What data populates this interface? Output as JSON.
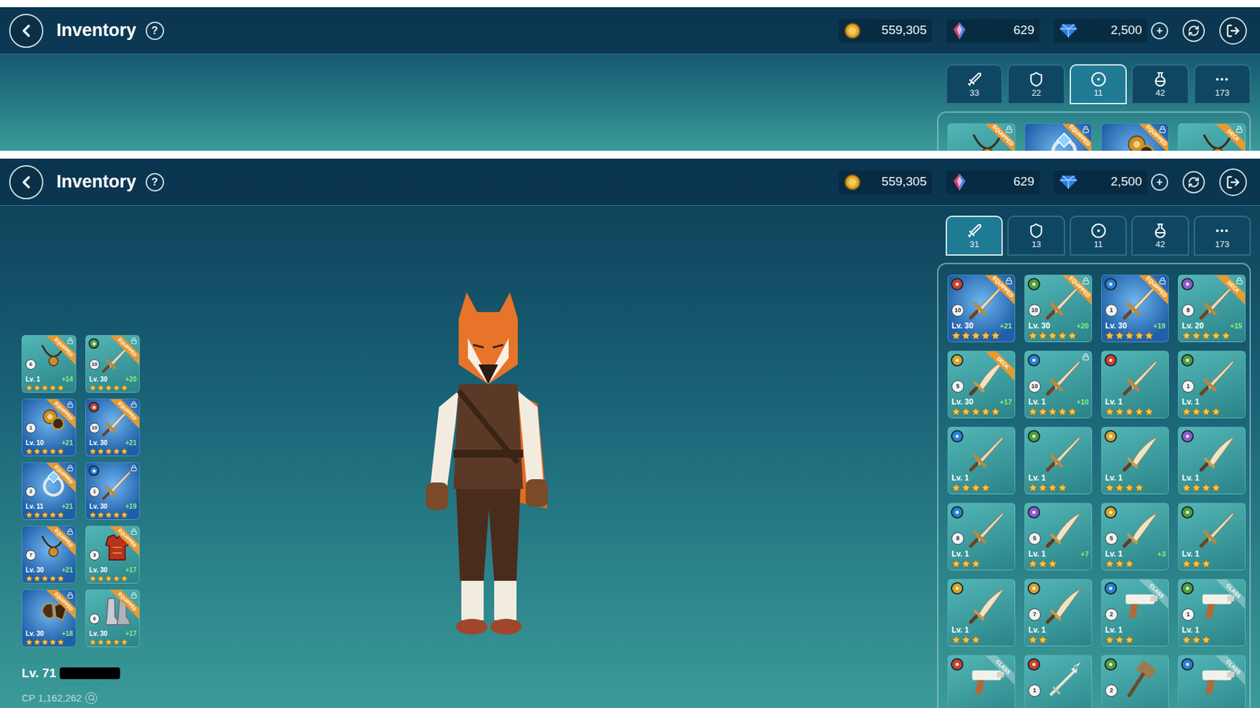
{
  "screens": [
    {
      "title": "Inventory",
      "help": "?",
      "add": "+",
      "currencies": [
        {
          "kind": "gold",
          "value": "559,305"
        },
        {
          "kind": "crystal",
          "value": "629"
        },
        {
          "kind": "gem",
          "value": "2,500"
        }
      ],
      "tabs": [
        {
          "kind": "weapon",
          "count": "33",
          "selected": false
        },
        {
          "kind": "armor",
          "count": "22",
          "selected": false
        },
        {
          "kind": "accessory",
          "count": "11",
          "selected": true
        },
        {
          "kind": "consumable",
          "count": "42",
          "selected": false
        },
        {
          "kind": "more",
          "count": "173",
          "selected": false
        }
      ],
      "items": [
        {
          "kind": "necklace",
          "badge": "EQUIPPED",
          "badge_kind": "status",
          "locked": true,
          "glow": false
        },
        {
          "kind": "ring",
          "badge": "EQUIPPED",
          "badge_kind": "status",
          "locked": true,
          "glow": true
        },
        {
          "kind": "jewel",
          "badge": "EQUIPPED",
          "badge_kind": "status",
          "locked": true,
          "glow": true
        },
        {
          "kind": "necklace",
          "badge": "DECK",
          "badge_kind": "status",
          "locked": true,
          "glow": false
        }
      ]
    },
    {
      "title": "Inventory",
      "help": "?",
      "add": "+",
      "currencies": [
        {
          "kind": "gold",
          "value": "559,305"
        },
        {
          "kind": "crystal",
          "value": "629"
        },
        {
          "kind": "gem",
          "value": "2,500"
        }
      ],
      "tabs": [
        {
          "kind": "weapon",
          "count": "31",
          "selected": true
        },
        {
          "kind": "armor",
          "count": "13",
          "selected": false
        },
        {
          "kind": "accessory",
          "count": "11",
          "selected": false
        },
        {
          "kind": "consumable",
          "count": "42",
          "selected": false
        },
        {
          "kind": "more",
          "count": "173",
          "selected": false
        }
      ],
      "items": [
        {
          "kind": "sword",
          "color": "#c8402f",
          "rank": "10",
          "level": "Lv. 30",
          "plus": "+21",
          "stars": 5,
          "badge": "EQUIPPED",
          "badge_kind": "status",
          "locked": true,
          "glow": true
        },
        {
          "kind": "sword",
          "color": "#4e9f3d",
          "rank": "10",
          "level": "Lv. 30",
          "plus": "+20",
          "stars": 5,
          "badge": "EQUIPPED",
          "badge_kind": "status",
          "locked": true,
          "glow": false
        },
        {
          "kind": "sword",
          "color": "#2a7fd4",
          "rank": "1",
          "level": "Lv. 30",
          "plus": "+19",
          "stars": 5,
          "badge": "EQUIPPED",
          "badge_kind": "status",
          "locked": true,
          "glow": true
        },
        {
          "kind": "sword",
          "color": "#8e5bc9",
          "rank": "8",
          "level": "Lv. 20",
          "plus": "+15",
          "stars": 5,
          "badge": "DECK",
          "badge_kind": "status",
          "locked": true,
          "glow": false
        },
        {
          "kind": "curved",
          "color": "#d4a52a",
          "rank": "5",
          "level": "Lv. 30",
          "plus": "+17",
          "stars": 5,
          "badge": "DECK",
          "badge_kind": "status",
          "locked": false,
          "glow": false
        },
        {
          "kind": "sword",
          "color": "#2a7fd4",
          "rank": "10",
          "level": "Lv. 1",
          "plus": "+10",
          "stars": 5,
          "locked": true,
          "glow": false
        },
        {
          "kind": "sword",
          "color": "#c8402f",
          "level": "Lv. 1",
          "stars": 5,
          "locked": false,
          "glow": false
        },
        {
          "kind": "sword",
          "color": "#4e9f3d",
          "rank": "1",
          "level": "Lv. 1",
          "stars": 4,
          "locked": false,
          "glow": false
        },
        {
          "kind": "sword",
          "color": "#2a7fd4",
          "level": "Lv. 1",
          "stars": 4,
          "locked": false,
          "glow": false
        },
        {
          "kind": "sword",
          "color": "#4e9f3d",
          "level": "Lv. 1",
          "stars": 4,
          "locked": false,
          "glow": false
        },
        {
          "kind": "curved",
          "color": "#d4a52a",
          "level": "Lv. 1",
          "stars": 4,
          "locked": false,
          "glow": false
        },
        {
          "kind": "curved",
          "color": "#8e5bc9",
          "level": "Lv. 1",
          "stars": 4,
          "locked": false,
          "glow": false
        },
        {
          "kind": "sword",
          "color": "#2a7fd4",
          "rank": "8",
          "level": "Lv. 1",
          "stars": 3,
          "locked": false,
          "glow": false
        },
        {
          "kind": "curved",
          "color": "#8e5bc9",
          "rank": "5",
          "level": "Lv. 1",
          "plus": "+7",
          "stars": 3,
          "locked": false,
          "glow": false
        },
        {
          "kind": "curved",
          "color": "#d4a52a",
          "rank": "5",
          "level": "Lv. 1",
          "plus": "+3",
          "stars": 3,
          "locked": false,
          "glow": false
        },
        {
          "kind": "sword",
          "color": "#4e9f3d",
          "level": "Lv. 1",
          "stars": 3,
          "locked": false,
          "glow": false
        },
        {
          "kind": "curved",
          "color": "#d4a52a",
          "level": "Lv. 1",
          "stars": 3,
          "locked": false,
          "glow": false
        },
        {
          "kind": "curved",
          "color": "#d4a52a",
          "rank": "7",
          "level": "Lv. 1",
          "stars": 2,
          "locked": false,
          "glow": false
        },
        {
          "kind": "gun",
          "color": "#2a7fd4",
          "rank": "2",
          "level": "Lv. 1",
          "stars": 3,
          "badge": "CLASS",
          "badge_kind": "class",
          "locked": false,
          "glow": false
        },
        {
          "kind": "gun",
          "color": "#4e9f3d",
          "rank": "1",
          "level": "Lv. 1",
          "stars": 3,
          "badge": "CLASS",
          "badge_kind": "class",
          "locked": false,
          "glow": false
        },
        {
          "kind": "gun",
          "color": "#c8402f",
          "badge": "CLASS",
          "badge_kind": "class",
          "locked": false,
          "glow": false
        },
        {
          "kind": "spear",
          "color": "#c8402f",
          "rank": "1",
          "locked": false,
          "glow": false
        },
        {
          "kind": "hammer",
          "color": "#4e9f3d",
          "rank": "2",
          "locked": false,
          "glow": false
        },
        {
          "kind": "gun",
          "color": "#2a7fd4",
          "badge": "CLASS",
          "badge_kind": "class",
          "locked": false,
          "glow": false
        }
      ],
      "equipped": [
        {
          "kind": "necklace",
          "rank": "6",
          "level": "Lv. 1",
          "plus": "+14",
          "stars": 5,
          "badge": "EQUIPPED",
          "badge_kind": "status",
          "locked": true,
          "glow": false
        },
        {
          "kind": "sword",
          "color": "#4e9f3d",
          "rank": "10",
          "level": "Lv. 30",
          "plus": "+20",
          "stars": 5,
          "badge": "EQUIPPED",
          "badge_kind": "status",
          "locked": true,
          "glow": false
        },
        {
          "kind": "jewel",
          "rank": "1",
          "level": "Lv. 10",
          "plus": "+21",
          "stars": 5,
          "badge": "EQUIPPED",
          "badge_kind": "status",
          "locked": true,
          "glow": true
        },
        {
          "kind": "sword",
          "color": "#c8402f",
          "rank": "10",
          "level": "Lv. 30",
          "plus": "+21",
          "stars": 5,
          "badge": "EQUIPPED",
          "badge_kind": "status",
          "locked": true,
          "glow": true
        },
        {
          "kind": "ring",
          "rank": "2",
          "level": "Lv. 11",
          "plus": "+21",
          "stars": 5,
          "badge": "EQUIPPED",
          "badge_kind": "status",
          "locked": true,
          "glow": true
        },
        {
          "kind": "sword",
          "color": "#2a7fd4",
          "rank": "1",
          "level": "Lv. 30",
          "plus": "+19",
          "stars": 5,
          "locked": true,
          "glow": true
        },
        {
          "kind": "necklace",
          "rank": "7",
          "level": "Lv. 30",
          "plus": "+21",
          "stars": 5,
          "badge": "EQUIPPED",
          "badge_kind": "status",
          "locked": true,
          "glow": true
        },
        {
          "kind": "armor",
          "rank": "3",
          "level": "Lv. 30",
          "plus": "+17",
          "stars": 5,
          "badge": "EQUIPPED",
          "badge_kind": "status",
          "locked": true,
          "glow": false
        },
        {
          "kind": "gloves",
          "level": "Lv. 30",
          "plus": "+18",
          "stars": 5,
          "badge": "EQUIPPED",
          "badge_kind": "status",
          "locked": true,
          "glow": true
        },
        {
          "kind": "boots",
          "rank": "6",
          "level": "Lv. 30",
          "plus": "+17",
          "stars": 5,
          "badge": "EQUIPPED",
          "badge_kind": "status",
          "locked": true,
          "glow": false
        }
      ],
      "player": {
        "level": "Lv. 71",
        "cp": "CP 1,162,262"
      }
    }
  ]
}
